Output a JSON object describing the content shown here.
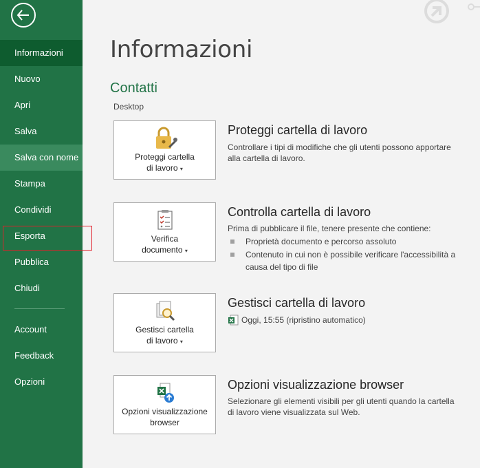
{
  "sidebar": {
    "items": [
      {
        "label": "Informazioni"
      },
      {
        "label": "Nuovo"
      },
      {
        "label": "Apri"
      },
      {
        "label": "Salva"
      },
      {
        "label": "Salva con nome"
      },
      {
        "label": "Stampa"
      },
      {
        "label": "Condividi"
      },
      {
        "label": "Esporta"
      },
      {
        "label": "Pubblica"
      },
      {
        "label": "Chiudi"
      },
      {
        "label": "Account"
      },
      {
        "label": "Feedback"
      },
      {
        "label": "Opzioni"
      }
    ]
  },
  "main": {
    "title": "Informazioni",
    "section": "Contatti",
    "location": "Desktop",
    "protect": {
      "btn_line1": "Proteggi cartella",
      "btn_line2": "di lavoro",
      "title": "Proteggi cartella di lavoro",
      "desc": "Controllare i tipi di modifiche che gli utenti possono apportare alla cartella di lavoro."
    },
    "inspect": {
      "btn_line1": "Verifica",
      "btn_line2": "documento",
      "title": "Controlla cartella di lavoro",
      "desc": "Prima di pubblicare il file, tenere presente che contiene:",
      "bullets": [
        "Proprietà documento e percorso assoluto",
        "Contenuto in cui non è possibile verificare l'accessibilità a causa del tipo di file"
      ]
    },
    "manage": {
      "btn_line1": "Gestisci cartella",
      "btn_line2": "di lavoro",
      "title": "Gestisci cartella di lavoro",
      "version": "Oggi, 15:55 (ripristino automatico)"
    },
    "browser": {
      "btn_line1": "Opzioni visualizzazione",
      "btn_line2": "browser",
      "title": "Opzioni visualizzazione browser",
      "desc": "Selezionare gli elementi visibili per gli utenti quando la cartella di lavoro viene visualizzata sul Web."
    }
  },
  "colors": {
    "sidebar": "#217346",
    "sidebar_active": "#0e5c2f",
    "accent": "#217346",
    "highlight": "#e0202a"
  }
}
